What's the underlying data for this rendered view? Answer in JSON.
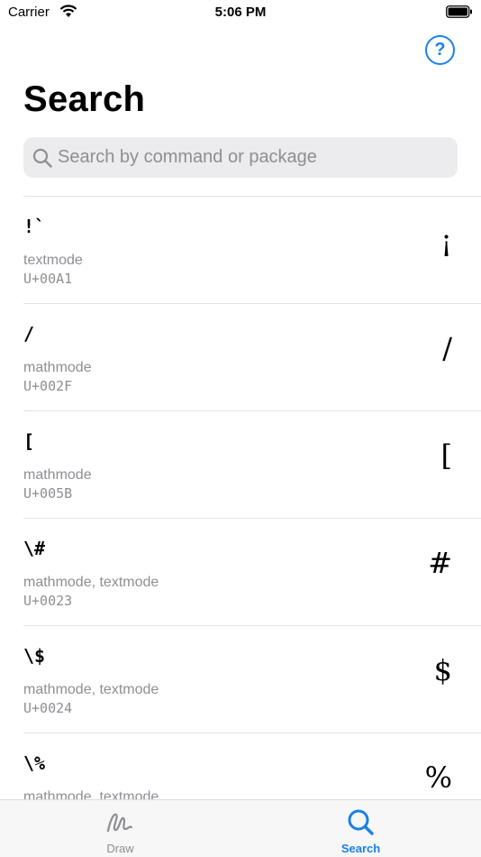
{
  "status": {
    "carrier": "Carrier",
    "time": "5:06 PM"
  },
  "header": {
    "help_label": "?"
  },
  "page": {
    "title": "Search"
  },
  "search": {
    "placeholder": "Search by command or package",
    "value": ""
  },
  "results": [
    {
      "command": "!`",
      "modes": "textmode",
      "unicode": "U+00A1",
      "glyph": "¡"
    },
    {
      "command": "/",
      "modes": "mathmode",
      "unicode": "U+002F",
      "glyph": "/"
    },
    {
      "command": "[",
      "modes": "mathmode",
      "unicode": "U+005B",
      "glyph": "["
    },
    {
      "command": "\\#",
      "modes": "mathmode, textmode",
      "unicode": "U+0023",
      "glyph": "#"
    },
    {
      "command": "\\$",
      "modes": "mathmode, textmode",
      "unicode": "U+0024",
      "glyph": "$"
    },
    {
      "command": "\\%",
      "modes": "mathmode, textmode",
      "unicode": "",
      "glyph": "%"
    }
  ],
  "tabs": [
    {
      "label": "Draw",
      "icon": "draw-icon",
      "selected": false
    },
    {
      "label": "Search",
      "icon": "search-icon",
      "selected": true
    }
  ],
  "colors": {
    "accent": "#1a80e6",
    "secondary_text": "#8e8e93",
    "separator": "#e3e3e6"
  }
}
